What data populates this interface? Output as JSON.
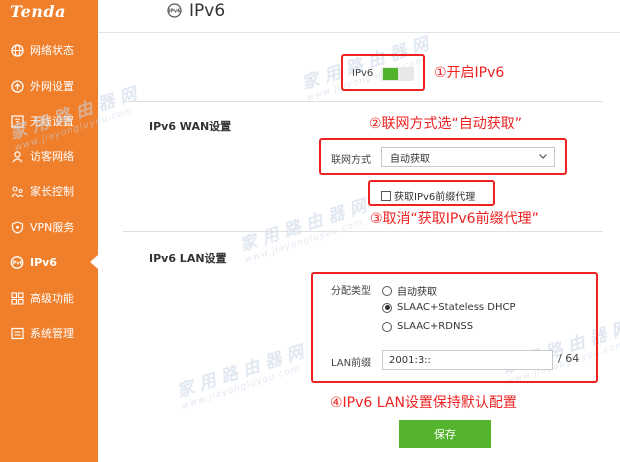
{
  "sidebar": {
    "brand": "Tenda",
    "items": [
      {
        "label": "网络状态",
        "icon": "globe-icon"
      },
      {
        "label": "外网设置",
        "icon": "internet-icon"
      },
      {
        "label": "无线设置",
        "icon": "wifi-icon"
      },
      {
        "label": "访客网络",
        "icon": "guest-user-icon"
      },
      {
        "label": "家长控制",
        "icon": "parental-control-icon"
      },
      {
        "label": "VPN服务",
        "icon": "vpn-shield-icon"
      },
      {
        "label": "IPv6",
        "icon": "ipv6-icon",
        "active": true
      },
      {
        "label": "高级功能",
        "icon": "grid-icon"
      },
      {
        "label": "系统管理",
        "icon": "system-icon"
      }
    ]
  },
  "header": {
    "title": "IPv6",
    "icon": "ipv6-icon"
  },
  "ipv6_switch": {
    "label": "IPv6",
    "enabled": true
  },
  "wan": {
    "title": "IPv6 WAN设置",
    "connection_label": "联网方式",
    "connection_value": "自动获取",
    "prefix_delegation_label": "获取IPv6前缀代理",
    "prefix_delegation_checked": false
  },
  "lan": {
    "title": "IPv6 LAN设置",
    "alloc_label": "分配类型",
    "options": [
      {
        "label": "自动获取",
        "selected": false
      },
      {
        "label": "SLAAC+Stateless DHCP",
        "selected": true
      },
      {
        "label": "SLAAC+RDNSS",
        "selected": false
      }
    ],
    "prefix_label": "LAN前缀",
    "prefix_value": "2001:3::",
    "prefix_length": "/ 64"
  },
  "save_label": "保存",
  "annotations": {
    "step1": "①开启IPv6",
    "step2": "②联网方式选“自动获取”",
    "step3": "③取消“获取IPv6前缀代理”",
    "step4": "④IPv6 LAN设置保持默认配置"
  },
  "watermark": {
    "cn": "家用路由器网",
    "en": "www.jiayongluyou.com"
  },
  "colors": {
    "sidebar": "#f07f2c",
    "accent_green": "#55b42d",
    "annotation_red": "#ee2222"
  }
}
